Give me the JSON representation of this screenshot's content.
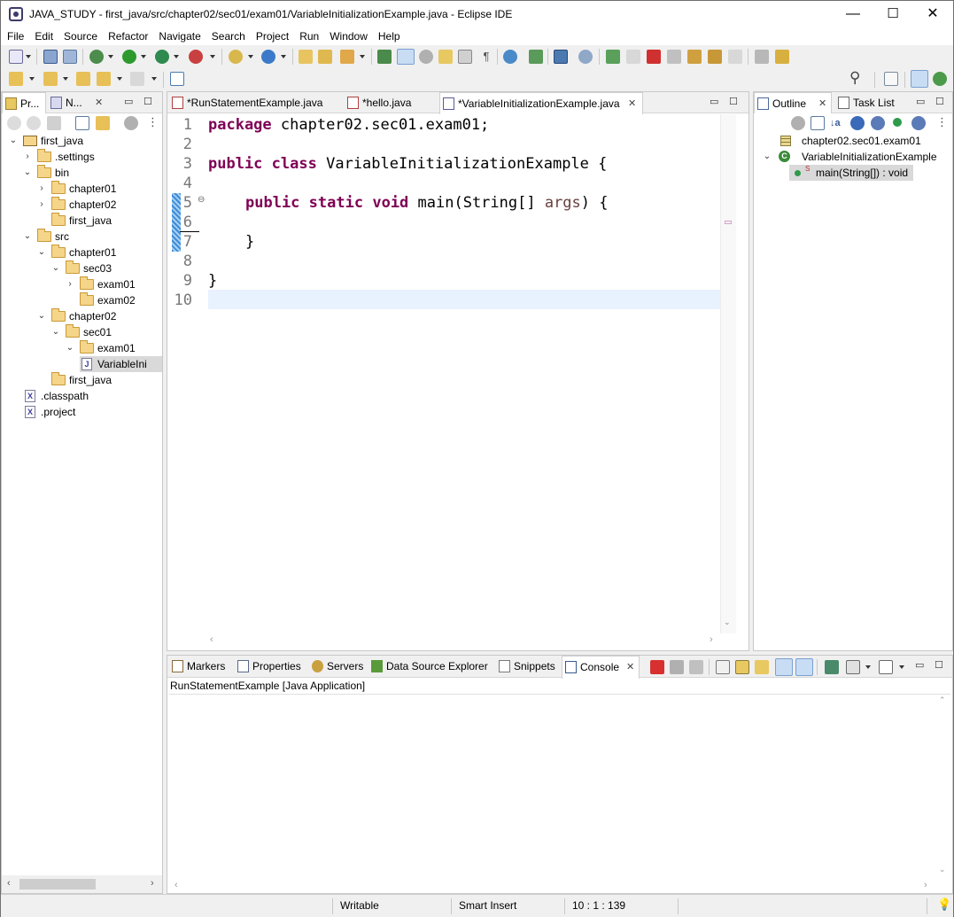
{
  "window": {
    "title": "JAVA_STUDY - first_java/src/chapter02/sec01/exam01/VariableInitializationExample.java - Eclipse IDE",
    "minimize": "—",
    "maximize": "☐",
    "close": "✕"
  },
  "menu": [
    "File",
    "Edit",
    "Source",
    "Refactor",
    "Navigate",
    "Search",
    "Project",
    "Run",
    "Window",
    "Help"
  ],
  "explorer": {
    "tabs": [
      {
        "label": "Pr..."
      },
      {
        "label": "N..."
      }
    ],
    "close": "✕",
    "min": "▭",
    "max": "☐",
    "tree": [
      {
        "label": "first_java",
        "twisty": "⌄",
        "icon": "project"
      },
      {
        "label": ".settings",
        "twisty": "›",
        "icon": "folder"
      },
      {
        "label": "bin",
        "twisty": "⌄",
        "icon": "folder"
      },
      {
        "label": "chapter01",
        "twisty": "›",
        "icon": "folder"
      },
      {
        "label": "chapter02",
        "twisty": "›",
        "icon": "folder"
      },
      {
        "label": "first_java",
        "twisty": "",
        "icon": "folder"
      },
      {
        "label": "src",
        "twisty": "⌄",
        "icon": "folder"
      },
      {
        "label": "chapter01",
        "twisty": "⌄",
        "icon": "folder"
      },
      {
        "label": "sec03",
        "twisty": "⌄",
        "icon": "folder"
      },
      {
        "label": "exam01",
        "twisty": "›",
        "icon": "folder"
      },
      {
        "label": "exam02",
        "twisty": "",
        "icon": "folder"
      },
      {
        "label": "chapter02",
        "twisty": "⌄",
        "icon": "folder"
      },
      {
        "label": "sec01",
        "twisty": "⌄",
        "icon": "folder"
      },
      {
        "label": "exam01",
        "twisty": "⌄",
        "icon": "folder"
      },
      {
        "label": "VariableIni",
        "twisty": "",
        "icon": "java"
      },
      {
        "label": "first_java",
        "twisty": "",
        "icon": "folder"
      },
      {
        "label": ".classpath",
        "twisty": "",
        "icon": "x"
      },
      {
        "label": ".project",
        "twisty": "",
        "icon": "x"
      }
    ]
  },
  "editor": {
    "tabs": [
      {
        "label": "*RunStatementExample.java"
      },
      {
        "label": "*hello.java"
      },
      {
        "label": "*VariableInitializationExample.java",
        "close": "✕"
      }
    ],
    "lines": [
      "1",
      "2",
      "3",
      "4",
      "5",
      "6",
      "7",
      "8",
      "9",
      "10"
    ],
    "code": {
      "l1_kw": "package",
      "l1_rest": " chapter02.sec01.exam01;",
      "l3_kw1": "public",
      "l3_kw2": "class",
      "l3_rest": " VariableInitializationExample {",
      "l5_kw1": "public",
      "l5_kw2": "static",
      "l5_kw3": "void",
      "l5_mid": " main(String[] ",
      "l5_param": "args",
      "l5_end": ") {",
      "l7": "}",
      "l9": "}"
    },
    "fold_marker": "⊖"
  },
  "outline": {
    "tabs": [
      {
        "label": "Outline"
      },
      {
        "label": "Task List"
      }
    ],
    "close": "✕",
    "items": [
      {
        "label": "chapter02.sec01.exam01"
      },
      {
        "label": "VariableInitializationExample",
        "twisty": "⌄"
      },
      {
        "label": "main(String[]) : void",
        "badge": "S"
      }
    ]
  },
  "bottom": {
    "tabs": [
      {
        "label": "Markers"
      },
      {
        "label": "Properties"
      },
      {
        "label": "Servers"
      },
      {
        "label": "Data Source Explorer"
      },
      {
        "label": "Snippets"
      },
      {
        "label": "Console"
      }
    ],
    "close": "✕",
    "console_header": "RunStatementExample [Java Application]"
  },
  "status": {
    "writable": "Writable",
    "insert_mode": "Smart Insert",
    "position": "10 : 1 : 139"
  },
  "colors": {
    "keyword": "#7f0055",
    "param": "#6a3e3e",
    "current_line": "#e8f2fe",
    "accent": "#3c8cd8"
  }
}
